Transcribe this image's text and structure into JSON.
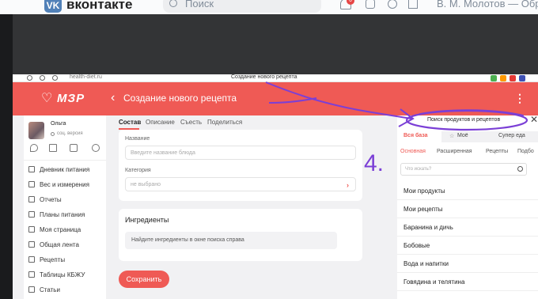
{
  "vk": {
    "logo": "VK",
    "brand": "вконтакте",
    "search_placeholder": "Поиск",
    "notif_count": "6",
    "user": "В. М. Молотов — Обра"
  },
  "browser": {
    "url": "health-diet.ru",
    "title": "Создание нового рецепта"
  },
  "header": {
    "logo": "МЗР",
    "back": "‹",
    "title": "Создание нового рецепта",
    "menu": "⋮"
  },
  "sidebar": {
    "user_name": "Ольга",
    "user_sub": "соц. версия",
    "items": [
      {
        "label": "Дневник питания",
        "icon": "diary-icon"
      },
      {
        "label": "Вес и измерения",
        "icon": "scale-icon"
      },
      {
        "label": "Отчеты",
        "icon": "report-icon"
      },
      {
        "label": "Планы питания",
        "icon": "plan-icon"
      },
      {
        "label": "Моя страница",
        "icon": "user-icon"
      },
      {
        "label": "Общая лента",
        "icon": "feed-icon"
      },
      {
        "label": "Рецепты",
        "icon": "recipe-icon"
      },
      {
        "label": "Таблицы КБЖУ",
        "icon": "table-icon"
      },
      {
        "label": "Статьи",
        "icon": "article-icon"
      }
    ]
  },
  "form": {
    "tabs": [
      "Состав",
      "Описание",
      "Съесть",
      "Поделиться"
    ],
    "name_label": "Название",
    "name_placeholder": "Введите название блюда",
    "category_label": "Категория",
    "category_value": "не выбрано",
    "ingredients_title": "Ингредиенты",
    "ingredients_hint": "Найдите ингредиенты в окне поиска справа",
    "save_label": "Сохранить"
  },
  "panel": {
    "title": "Поиск продуктов и рецептов",
    "close": "✕",
    "tabs": [
      "Вся база",
      "Моё",
      "Супер еда"
    ],
    "categories": [
      "Основная",
      "Расширенная",
      "Рецепты",
      "Подбо"
    ],
    "search_placeholder": "Что искать?",
    "items": [
      "Мои продукты",
      "Мои рецепты",
      "Баранина и дичь",
      "Бобовые",
      "Вода и напитки",
      "Говядина и телятина"
    ]
  },
  "annotation": {
    "number": "4."
  },
  "colors": {
    "brand": "#ef5a55",
    "annotation": "#7b3fd6"
  }
}
